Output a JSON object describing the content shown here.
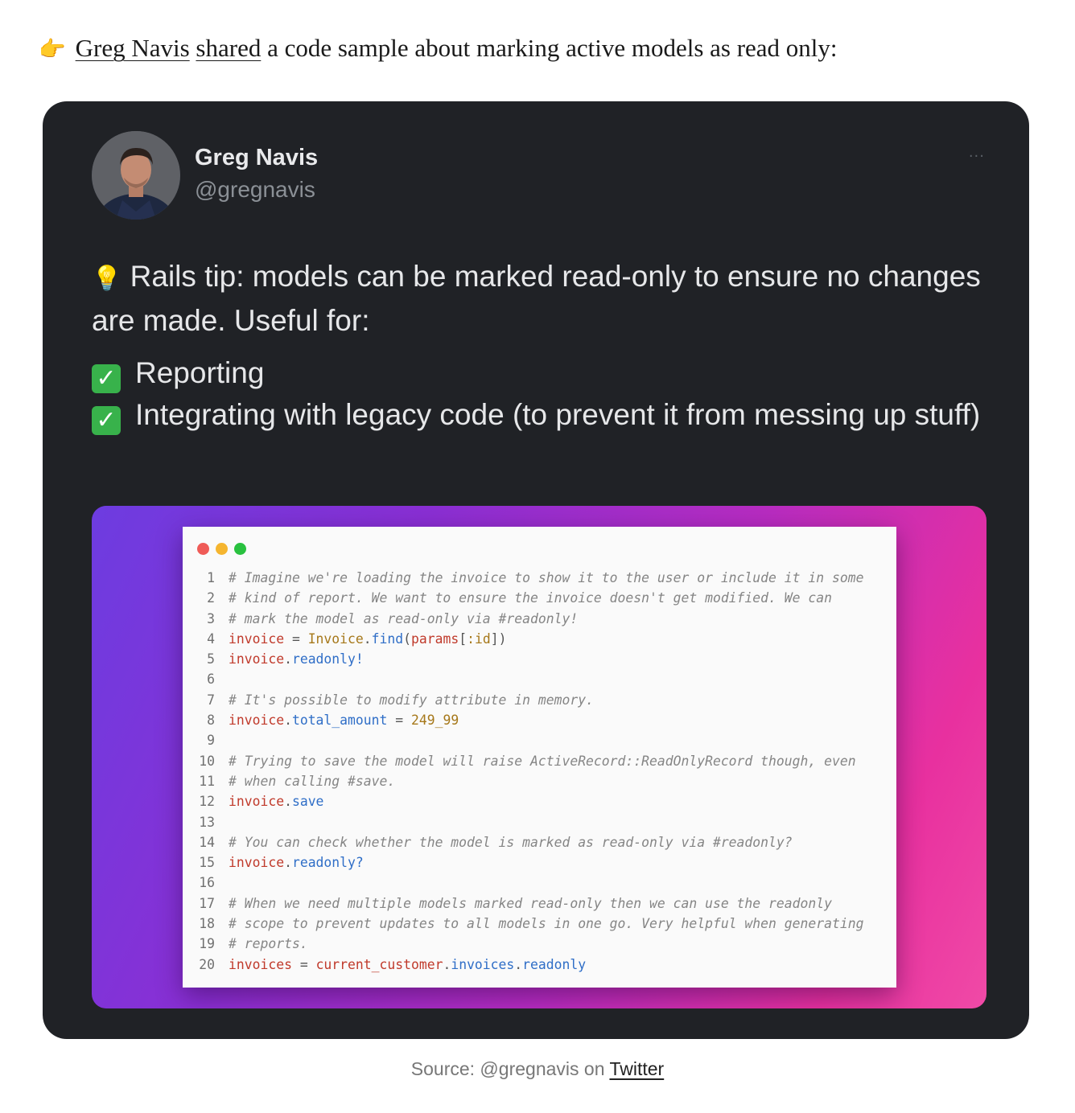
{
  "intro": {
    "emoji": "👉",
    "author_link": "Greg Navis",
    "shared_link": "shared",
    "rest": " a code sample about marking active models as read only:"
  },
  "tweet": {
    "author_name": "Greg Navis",
    "author_handle": "@gregnavis",
    "more_icon": "···",
    "bulb_icon": "💡",
    "line1": "Rails tip: models can be marked read-only to ensure no changes are made. Useful for:",
    "check_icon": "✓",
    "bullet1": "Reporting",
    "bullet2": "Integrating with legacy code (to prevent it from messing up stuff)"
  },
  "code_window_controls": [
    "close",
    "minimize",
    "maximize"
  ],
  "code": {
    "lines": [
      {
        "n": "1",
        "parts": [
          [
            "comment",
            "# Imagine we're loading the invoice to show it to the user or include it in some"
          ]
        ]
      },
      {
        "n": "2",
        "parts": [
          [
            "comment",
            "# kind of report. We want to ensure the invoice doesn't get modified. We can"
          ]
        ]
      },
      {
        "n": "3",
        "parts": [
          [
            "comment",
            "# mark the model as read-only via #readonly!"
          ]
        ]
      },
      {
        "n": "4",
        "parts": [
          [
            "var",
            "invoice"
          ],
          [
            "op",
            " = "
          ],
          [
            "const",
            "Invoice"
          ],
          [
            "op",
            "."
          ],
          [
            "method",
            "find"
          ],
          [
            "op",
            "("
          ],
          [
            "var",
            "params"
          ],
          [
            "op",
            "["
          ],
          [
            "const",
            ":id"
          ],
          [
            "op",
            "])"
          ]
        ]
      },
      {
        "n": "5",
        "parts": [
          [
            "var",
            "invoice"
          ],
          [
            "op",
            "."
          ],
          [
            "method",
            "readonly!"
          ]
        ]
      },
      {
        "n": "6",
        "parts": []
      },
      {
        "n": "7",
        "parts": [
          [
            "comment",
            "# It's possible to modify attribute in memory."
          ]
        ]
      },
      {
        "n": "8",
        "parts": [
          [
            "var",
            "invoice"
          ],
          [
            "op",
            "."
          ],
          [
            "method",
            "total_amount"
          ],
          [
            "op",
            " = "
          ],
          [
            "num",
            "249_99"
          ]
        ]
      },
      {
        "n": "9",
        "parts": []
      },
      {
        "n": "10",
        "parts": [
          [
            "comment",
            "# Trying to save the model will raise ActiveRecord::ReadOnlyRecord though, even"
          ]
        ]
      },
      {
        "n": "11",
        "parts": [
          [
            "comment",
            "# when calling #save."
          ]
        ]
      },
      {
        "n": "12",
        "parts": [
          [
            "var",
            "invoice"
          ],
          [
            "op",
            "."
          ],
          [
            "method",
            "save"
          ]
        ]
      },
      {
        "n": "13",
        "parts": []
      },
      {
        "n": "14",
        "parts": [
          [
            "comment",
            "# You can check whether the model is marked as read-only via #readonly?"
          ]
        ]
      },
      {
        "n": "15",
        "parts": [
          [
            "var",
            "invoice"
          ],
          [
            "op",
            "."
          ],
          [
            "method",
            "readonly?"
          ]
        ]
      },
      {
        "n": "16",
        "parts": []
      },
      {
        "n": "17",
        "parts": [
          [
            "comment",
            "# When we need multiple models marked read-only then we can use the readonly"
          ]
        ]
      },
      {
        "n": "18",
        "parts": [
          [
            "comment",
            "# scope to prevent updates to all models in one go. Very helpful when generating"
          ]
        ]
      },
      {
        "n": "19",
        "parts": [
          [
            "comment",
            "# reports."
          ]
        ]
      },
      {
        "n": "20",
        "parts": [
          [
            "var",
            "invoices"
          ],
          [
            "op",
            " = "
          ],
          [
            "var",
            "current_customer"
          ],
          [
            "op",
            "."
          ],
          [
            "method",
            "invoices"
          ],
          [
            "op",
            "."
          ],
          [
            "method",
            "readonly"
          ]
        ]
      }
    ]
  },
  "caption": {
    "text": "Source: @gregnavis on ",
    "link": "Twitter"
  }
}
